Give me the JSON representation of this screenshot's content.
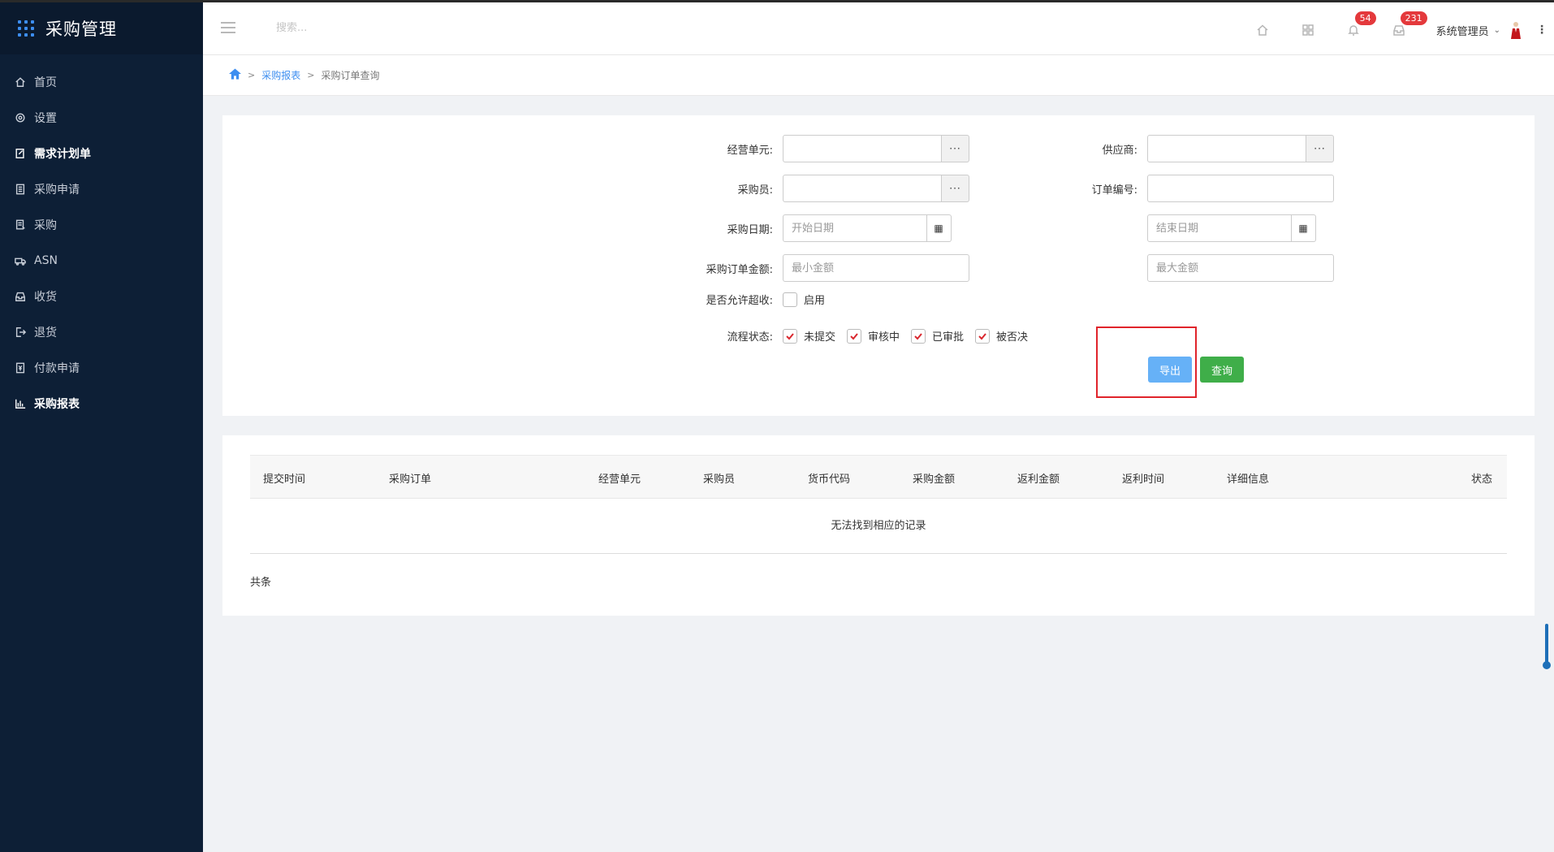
{
  "app": {
    "title": "采购管理"
  },
  "sidebar": {
    "items": [
      {
        "label": "首页",
        "icon": "home-icon",
        "active": false
      },
      {
        "label": "设置",
        "icon": "gear-icon",
        "active": false
      },
      {
        "label": "需求计划单",
        "icon": "edit-doc-icon",
        "active": true
      },
      {
        "label": "采购申请",
        "icon": "document-icon",
        "active": false
      },
      {
        "label": "采购",
        "icon": "list-doc-icon",
        "active": false
      },
      {
        "label": "ASN",
        "icon": "truck-icon",
        "active": false
      },
      {
        "label": "收货",
        "icon": "inbox-icon",
        "active": false
      },
      {
        "label": "退货",
        "icon": "sign-out-icon",
        "active": false
      },
      {
        "label": "付款申请",
        "icon": "payment-icon",
        "active": false
      },
      {
        "label": "采购报表",
        "icon": "bar-chart-icon",
        "active": true
      }
    ]
  },
  "topbar": {
    "search_placeholder": "搜索...",
    "notifications_count": "54",
    "messages_count": "231",
    "user_name": "系统管理员"
  },
  "breadcrumb": {
    "parent": "采购报表",
    "current": "采购订单查询"
  },
  "filter": {
    "business_unit_label": "经营单元:",
    "supplier_label": "供应商:",
    "buyer_label": "采购员:",
    "order_no_label": "订单编号:",
    "date_label": "采购日期:",
    "start_date_placeholder": "开始日期",
    "end_date_placeholder": "结束日期",
    "amount_label": "采购订单金额:",
    "min_amount_placeholder": "最小金额",
    "max_amount_placeholder": "最大金额",
    "over_receive_label": "是否允许超收:",
    "over_receive_option": "启用",
    "status_label": "流程状态:",
    "status_options": [
      "未提交",
      "审核中",
      "已审批",
      "被否决"
    ],
    "lookup_glyph": "···",
    "export_button": "导出",
    "query_button": "查询"
  },
  "table": {
    "columns": [
      "提交时间",
      "采购订单",
      "经营单元",
      "采购员",
      "货币代码",
      "采购金额",
      "返利金额",
      "返利时间",
      "详细信息",
      "状态"
    ],
    "empty_text": "无法找到相应的记录",
    "total_text": "共条"
  },
  "colors": {
    "sidebar_bg": "#0d1f36",
    "accent": "#3d8ef0",
    "export_btn": "#66b1f7",
    "query_btn": "#3fae49",
    "badge": "#e4393c",
    "highlight": "#e0242b"
  }
}
